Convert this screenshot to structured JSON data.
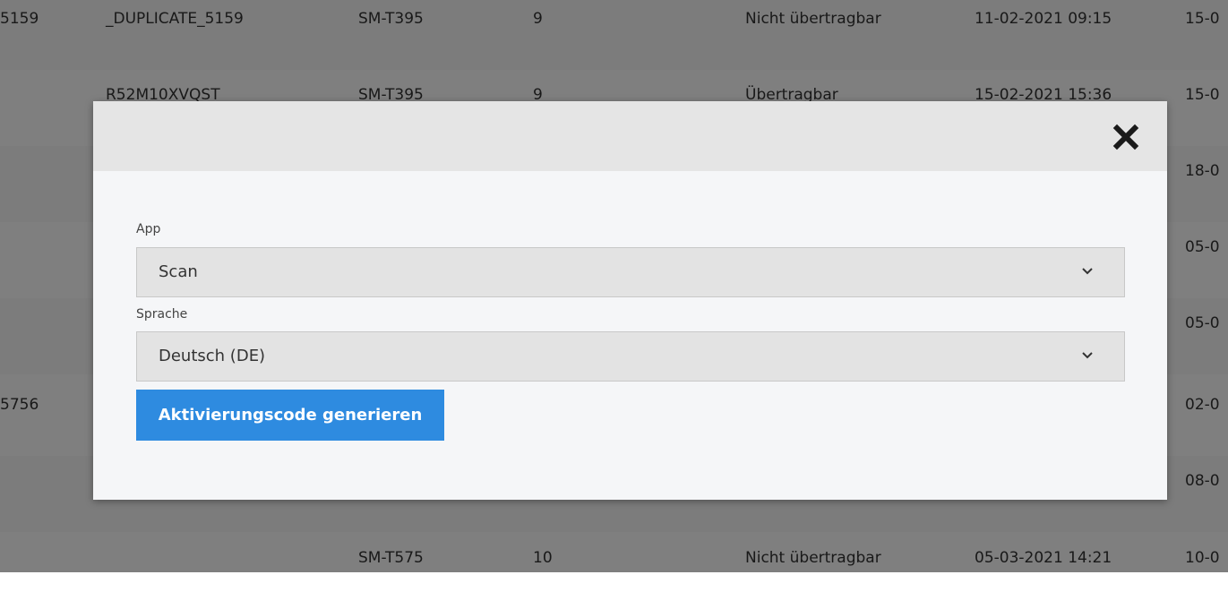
{
  "table": {
    "rows": [
      {
        "cells": [
          "5159",
          "_DUPLICATE_5159",
          "SM-T395",
          "9",
          "Nicht übertragbar",
          "11-02-2021 09:15",
          "15-0"
        ]
      },
      {
        "cells": [
          "",
          "R52M10XVQST",
          "SM-T395",
          "9",
          "Übertragbar",
          "15-02-2021 15:36",
          "15-0"
        ]
      },
      {
        "cells": [
          "",
          "",
          "",
          "",
          "",
          "",
          "18-0"
        ]
      },
      {
        "cells": [
          "",
          "",
          "",
          "",
          "",
          "",
          "05-0"
        ]
      },
      {
        "cells": [
          "",
          "",
          "",
          "",
          "",
          "",
          "05-0"
        ]
      },
      {
        "cells": [
          "5756",
          "",
          "",
          "",
          "",
          "",
          "02-0"
        ]
      },
      {
        "cells": [
          "",
          "",
          "",
          "",
          "",
          "",
          "08-0"
        ]
      },
      {
        "cells": [
          "",
          "",
          "SM-T575",
          "10",
          "Nicht übertragbar",
          "05-03-2021 14:21",
          "10-0"
        ]
      }
    ]
  },
  "modal": {
    "close_icon": "close-icon",
    "app": {
      "label": "App",
      "value": "Scan"
    },
    "language": {
      "label": "Sprache",
      "value": "Deutsch (DE)"
    },
    "generate_button": "Aktivierungscode generieren"
  }
}
